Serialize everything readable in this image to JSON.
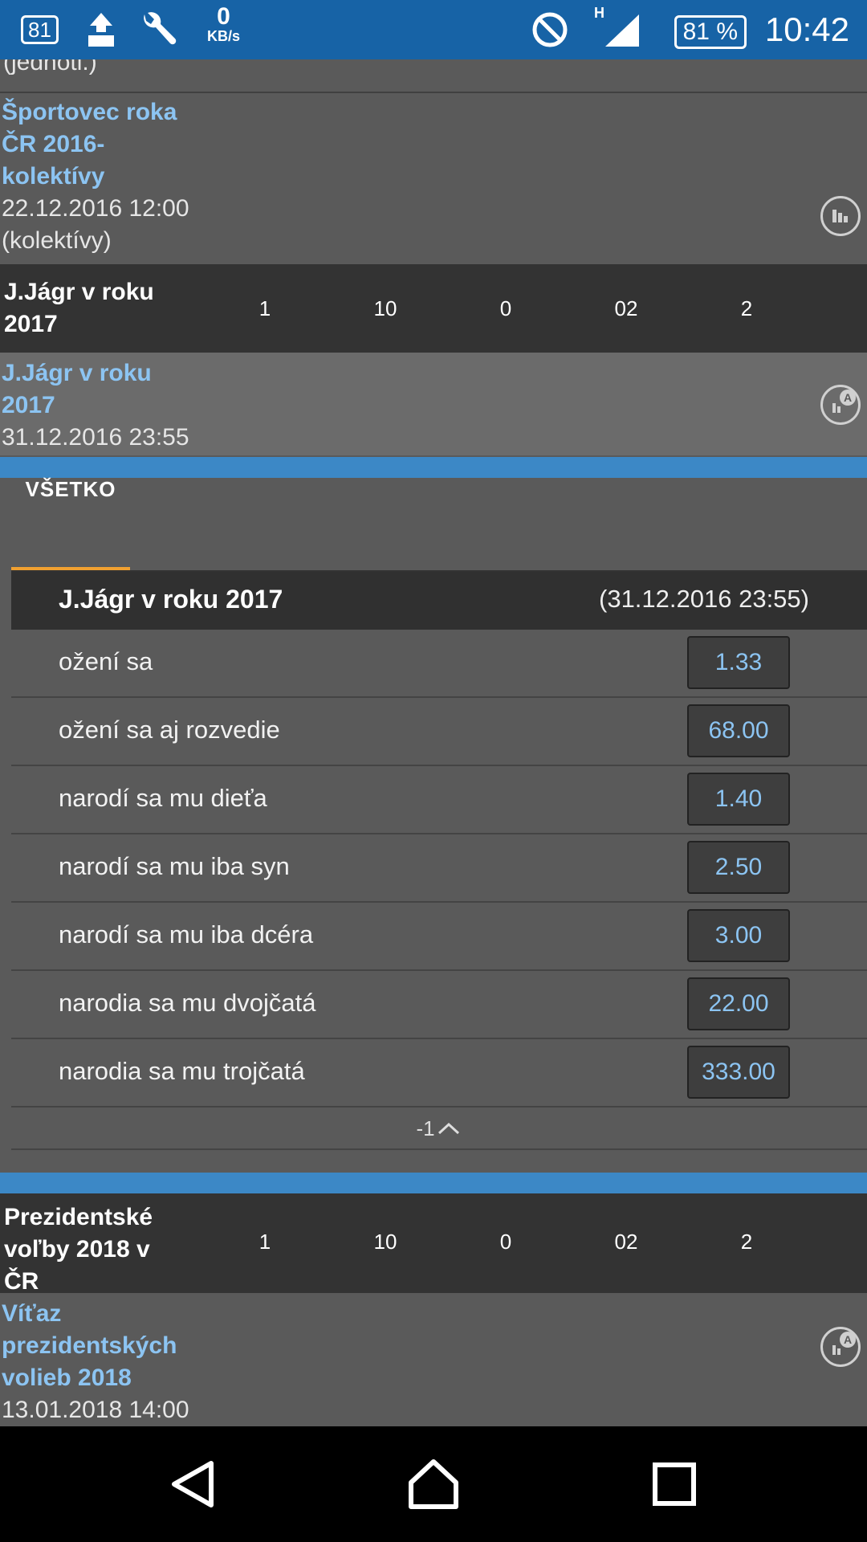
{
  "status_bar": {
    "notif_badge": "81",
    "speed_value": "0",
    "speed_unit": "KB/s",
    "network_type": "H",
    "battery": "81 %",
    "time": "10:42"
  },
  "events": [
    {
      "name": "",
      "meta": "(jednotl.)"
    },
    {
      "name": "Športovec roka ČR 2016- kolektívy",
      "meta1": "22.12.2016 12:00",
      "meta2": "(kolektívy)"
    },
    {
      "name": "J.Jágr v roku 2017",
      "meta1": "31.12.2016 23:55"
    },
    {
      "name": "Víťaz prezidentských volieb 2018",
      "meta1": "13.01.2018 14:00"
    }
  ],
  "header_rows": [
    {
      "title": "J.Jágr v roku 2017",
      "cols": [
        "1",
        "10",
        "0",
        "02",
        "2"
      ]
    },
    {
      "title": "Prezidentské voľby 2018 v ČR",
      "cols": [
        "1",
        "10",
        "0",
        "02",
        "2"
      ]
    }
  ],
  "tab": {
    "label": "VŠETKO"
  },
  "market": {
    "title": "J.Jágr v roku 2017",
    "date": "(31.12.2016 23:55)",
    "options": [
      {
        "label": "ožení sa",
        "odd": "1.33"
      },
      {
        "label": "ožení sa aj rozvedie",
        "odd": "68.00"
      },
      {
        "label": "narodí sa mu dieťa",
        "odd": "1.40"
      },
      {
        "label": "narodí sa mu iba syn",
        "odd": "2.50"
      },
      {
        "label": "narodí sa mu iba dcéra",
        "odd": "3.00"
      },
      {
        "label": "narodia sa mu dvojčatá",
        "odd": "22.00"
      },
      {
        "label": "narodia sa mu trojčatá",
        "odd": "333.00"
      }
    ],
    "collapse_label": "-1"
  },
  "icons": {
    "stats": "stats-icon",
    "live_stats": "live-stats-icon",
    "back": "back-icon",
    "home": "home-icon",
    "recents": "recents-icon"
  },
  "colors": {
    "status_bar": "#1763a6",
    "link": "#8cc4f2",
    "accent": "#f0a030",
    "divider_blue": "#3c88c6"
  }
}
